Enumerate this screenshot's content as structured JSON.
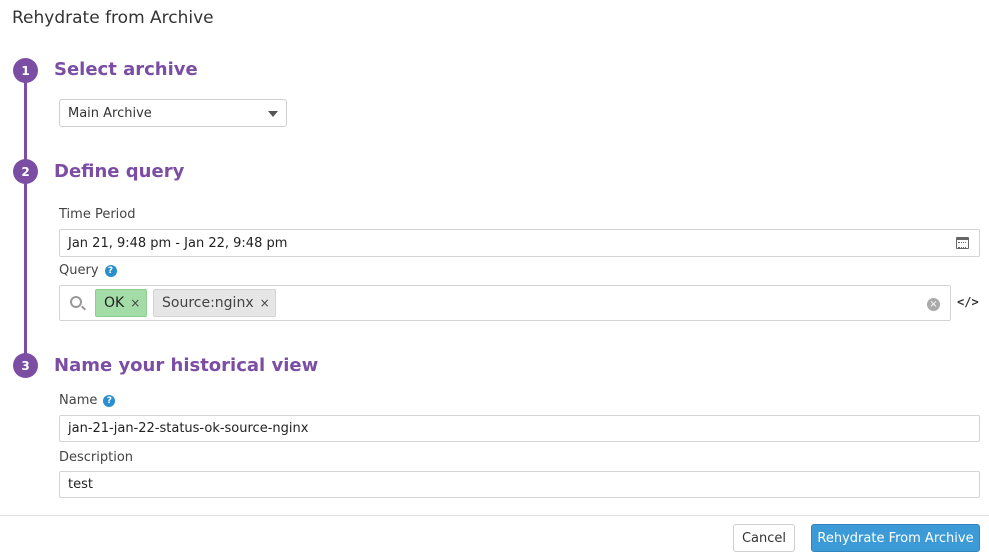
{
  "dialog": {
    "title": "Rehydrate from Archive"
  },
  "steps": [
    {
      "number": "1",
      "title": "Select archive"
    },
    {
      "number": "2",
      "title": "Define query"
    },
    {
      "number": "3",
      "title": "Name your historical view"
    }
  ],
  "archive": {
    "selected": "Main Archive"
  },
  "time_period": {
    "label": "Time Period",
    "value": "Jan 21, 9:48 pm - Jan 22, 9:48 pm"
  },
  "query": {
    "label": "Query",
    "help": "?",
    "tags": [
      {
        "text": "OK",
        "remove": "×"
      },
      {
        "text": "Source:nginx",
        "remove": "×"
      }
    ],
    "clear": "×",
    "code_toggle": "</>"
  },
  "name": {
    "label": "Name",
    "help": "?",
    "value": "jan-21-jan-22-status-ok-source-nginx"
  },
  "description": {
    "label": "Description",
    "value": "test"
  },
  "actions": {
    "cancel": "Cancel",
    "submit": "Rehydrate From Archive"
  },
  "colors": {
    "accent": "#7b4ea3",
    "primary_button": "#3c9bd6",
    "ok_tag": "#a3dca7"
  }
}
